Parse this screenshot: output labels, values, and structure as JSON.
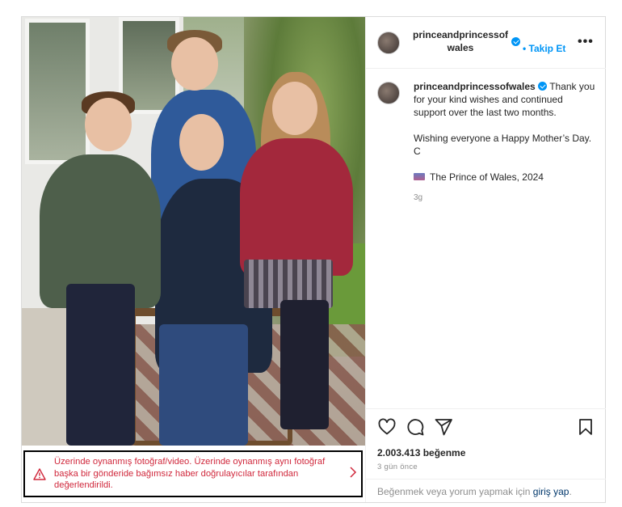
{
  "post": {
    "username_line1": "princeandprincessof",
    "username_line2": "wales",
    "follow_label": "Takip Et",
    "more_label": "•••",
    "caption_username": "princeandprincessofwales",
    "caption_text": "Thank you for your kind wishes and continued support over the last two months.",
    "caption_wish": "Wishing everyone a Happy Mother’s Day. C",
    "caption_credit": "The Prince of Wales, 2024",
    "caption_time": "3g",
    "likes": "2.003.413 beğenme",
    "posted_ago": "3 gün önce",
    "login_prompt": "Beğenmek veya yorum yapmak için",
    "login_link": "giriş yap",
    "login_suffix": "."
  },
  "warning": {
    "text": "Üzerinde oynanmış fotoğraf/video. Üzerinde oynanmış aynı fotoğraf başka bir gönderide bağımsız haber doğrulayıcılar tarafından değerlendirildi.",
    "color": "#d0283c"
  },
  "icons": {
    "like": "heart-icon",
    "comment": "comment-icon",
    "share": "send-icon",
    "save": "bookmark-icon",
    "warning": "warning-triangle-icon",
    "chevron": "chevron-right-icon",
    "verified": "verified-badge-icon"
  },
  "colors": {
    "accent": "#0095f6",
    "warning": "#d0283c",
    "link": "#00376b"
  }
}
